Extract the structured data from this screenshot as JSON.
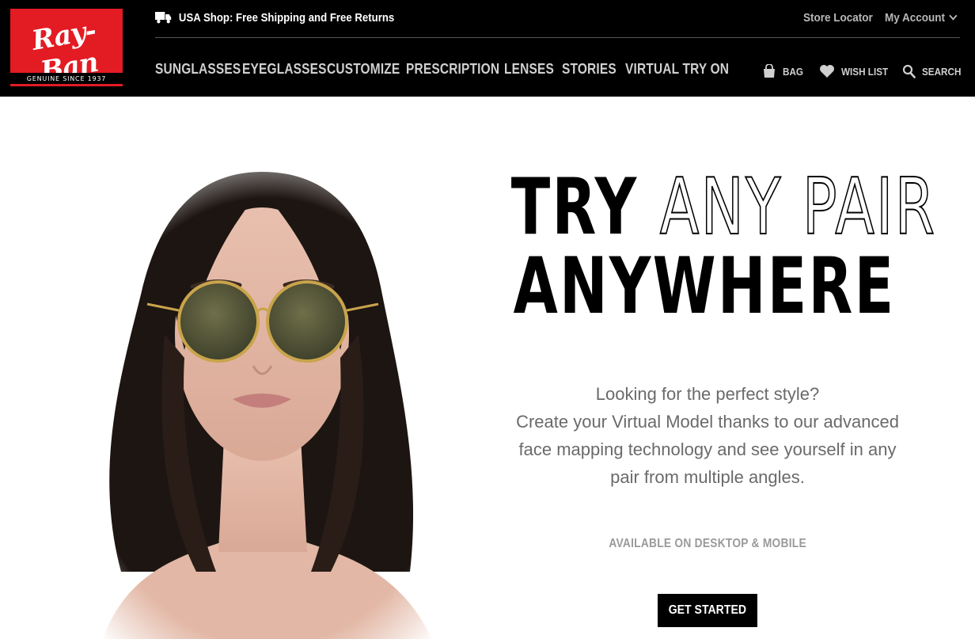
{
  "brand": {
    "logo_text": "Ray-Ban",
    "tagline": "GENUINE SINCE 1937",
    "accent_color": "#e31b23"
  },
  "header": {
    "promo_icon": "truck-icon",
    "promo_text": "USA Shop: Free Shipping and Free Returns",
    "store_locator": "Store Locator",
    "my_account": "My Account",
    "nav": [
      "SUNGLASSES",
      "EYEGLASSES",
      "CUSTOMIZE",
      "PRESCRIPTION",
      "LENSES",
      "STORIES",
      "VIRTUAL TRY ON"
    ],
    "tools": {
      "bag": "BAG",
      "wishlist": "WISH LIST",
      "search": "SEARCH"
    }
  },
  "hero": {
    "headline_word_1": "TRY",
    "headline_word_2": "ANY PAIR",
    "headline_line_2": "ANYWHERE",
    "description_lines": [
      "Looking for the perfect style?",
      "Create your Virtual Model thanks to our advanced",
      "face mapping technology and see yourself in any",
      "pair from multiple angles."
    ],
    "availability": "AVAILABLE ON DESKTOP & MOBILE",
    "cta": "GET STARTED"
  }
}
